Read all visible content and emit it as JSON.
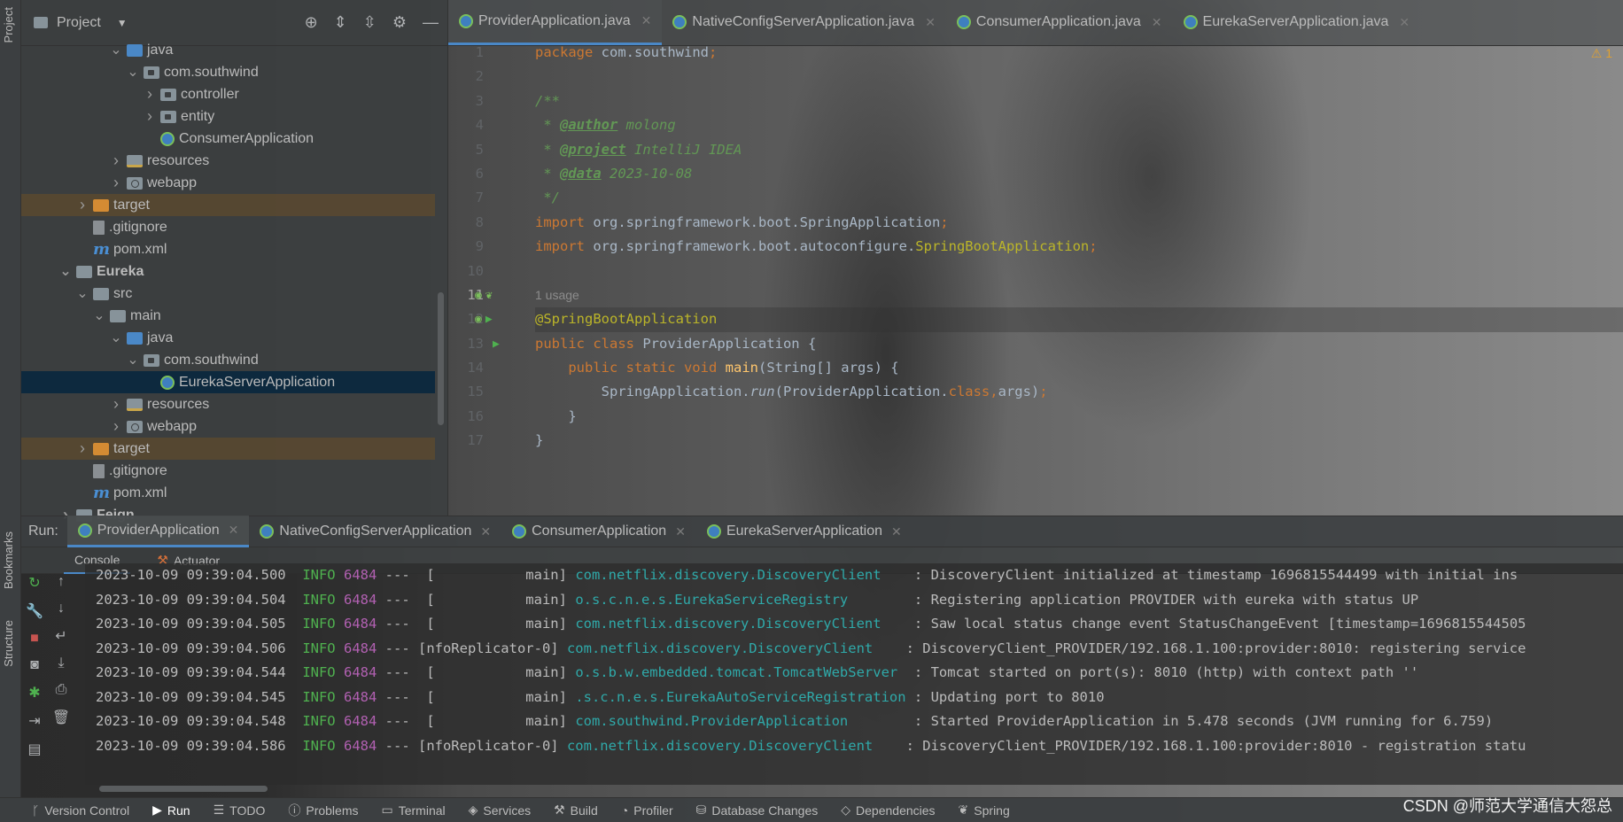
{
  "project_panel": {
    "title": "Project",
    "tree": [
      {
        "label": "java",
        "indent": 5,
        "icon": "folder-blue",
        "chev": "v"
      },
      {
        "label": "com.southwind",
        "indent": 6,
        "icon": "pkg",
        "chev": "v"
      },
      {
        "label": "controller",
        "indent": 7,
        "icon": "pkg",
        "chev": ">"
      },
      {
        "label": "entity",
        "indent": 7,
        "icon": "pkg",
        "chev": ">"
      },
      {
        "label": "ConsumerApplication",
        "indent": 7,
        "icon": "spring",
        "chev": ""
      },
      {
        "label": "resources",
        "indent": 5,
        "icon": "folder-res",
        "chev": ">"
      },
      {
        "label": "webapp",
        "indent": 5,
        "icon": "web",
        "chev": ">"
      },
      {
        "label": "target",
        "indent": 3,
        "icon": "folder-orange",
        "chev": ">",
        "hl": true
      },
      {
        "label": ".gitignore",
        "indent": 3,
        "icon": "file",
        "chev": ""
      },
      {
        "label": "pom.xml",
        "indent": 3,
        "icon": "maven",
        "chev": ""
      },
      {
        "label": "Eureka",
        "indent": 2,
        "icon": "folder",
        "chev": "v",
        "bold": true
      },
      {
        "label": "src",
        "indent": 3,
        "icon": "folder",
        "chev": "v"
      },
      {
        "label": "main",
        "indent": 4,
        "icon": "folder",
        "chev": "v"
      },
      {
        "label": "java",
        "indent": 5,
        "icon": "folder-blue",
        "chev": "v"
      },
      {
        "label": "com.southwind",
        "indent": 6,
        "icon": "pkg",
        "chev": "v"
      },
      {
        "label": "EurekaServerApplication",
        "indent": 7,
        "icon": "spring",
        "chev": "",
        "sel": true
      },
      {
        "label": "resources",
        "indent": 5,
        "icon": "folder-res",
        "chev": ">"
      },
      {
        "label": "webapp",
        "indent": 5,
        "icon": "web",
        "chev": ">"
      },
      {
        "label": "target",
        "indent": 3,
        "icon": "folder-orange",
        "chev": ">",
        "hl": true
      },
      {
        "label": ".gitignore",
        "indent": 3,
        "icon": "file",
        "chev": ""
      },
      {
        "label": "pom.xml",
        "indent": 3,
        "icon": "maven",
        "chev": ""
      },
      {
        "label": "Feign",
        "indent": 2,
        "icon": "folder",
        "chev": ">",
        "bold": true
      }
    ]
  },
  "editor": {
    "tabs": [
      {
        "label": "ProviderApplication.java",
        "active": true
      },
      {
        "label": "NativeConfigServerApplication.java",
        "active": false
      },
      {
        "label": "ConsumerApplication.java",
        "active": false
      },
      {
        "label": "EurekaServerApplication.java",
        "active": false
      }
    ],
    "warning_count": "1",
    "usage_hint": "1 usage",
    "line_numbers": [
      "1",
      "2",
      "3",
      "4",
      "5",
      "6",
      "7",
      "8",
      "9",
      "10",
      "11",
      "12",
      "13",
      "14",
      "15",
      "16",
      "17"
    ]
  },
  "run_panel": {
    "label": "Run:",
    "tabs": [
      {
        "label": "ProviderApplication",
        "active": true
      },
      {
        "label": "NativeConfigServerApplication",
        "active": false
      },
      {
        "label": "ConsumerApplication",
        "active": false
      },
      {
        "label": "EurekaServerApplication",
        "active": false
      }
    ],
    "sub_tabs": [
      "Console",
      "Actuator"
    ],
    "console_lines": [
      {
        "ts": "2023-10-09 09:39:04.500",
        "level": "INFO",
        "pid": "6484",
        "thread": "---  [           main]",
        "logger": "com.netflix.discovery.DiscoveryClient   ",
        "msg": " : DiscoveryClient initialized at timestamp 1696815544499 with initial ins"
      },
      {
        "ts": "2023-10-09 09:39:04.504",
        "level": "INFO",
        "pid": "6484",
        "thread": "---  [           main]",
        "logger": "o.s.c.n.e.s.EurekaServiceRegistry       ",
        "msg": " : Registering application PROVIDER with eureka with status UP"
      },
      {
        "ts": "2023-10-09 09:39:04.505",
        "level": "INFO",
        "pid": "6484",
        "thread": "---  [           main]",
        "logger": "com.netflix.discovery.DiscoveryClient   ",
        "msg": " : Saw local status change event StatusChangeEvent [timestamp=1696815544505"
      },
      {
        "ts": "2023-10-09 09:39:04.506",
        "level": "INFO",
        "pid": "6484",
        "thread": "--- [nfoReplicator-0]",
        "logger": "com.netflix.discovery.DiscoveryClient   ",
        "msg": " : DiscoveryClient_PROVIDER/192.168.1.100:provider:8010: registering service"
      },
      {
        "ts": "2023-10-09 09:39:04.544",
        "level": "INFO",
        "pid": "6484",
        "thread": "---  [           main]",
        "logger": "o.s.b.w.embedded.tomcat.TomcatWebServer ",
        "msg": " : Tomcat started on port(s): 8010 (http) with context path ''"
      },
      {
        "ts": "2023-10-09 09:39:04.545",
        "level": "INFO",
        "pid": "6484",
        "thread": "---  [           main]",
        "logger": ".s.c.n.e.s.EurekaAutoServiceRegistration",
        "msg": " : Updating port to 8010"
      },
      {
        "ts": "2023-10-09 09:39:04.548",
        "level": "INFO",
        "pid": "6484",
        "thread": "---  [           main]",
        "logger": "com.southwind.ProviderApplication       ",
        "msg": " : Started ProviderApplication in 5.478 seconds (JVM running for 6.759)"
      },
      {
        "ts": "2023-10-09 09:39:04.586",
        "level": "INFO",
        "pid": "6484",
        "thread": "--- [nfoReplicator-0]",
        "logger": "com.netflix.discovery.DiscoveryClient   ",
        "msg": " : DiscoveryClient_PROVIDER/192.168.1.100:provider:8010 - registration statu"
      }
    ]
  },
  "left_strip": {
    "project": "Project",
    "bookmarks": "Bookmarks",
    "structure": "Structure"
  },
  "statusbar": [
    {
      "label": "Version Control",
      "icon": "branch-icon"
    },
    {
      "label": "Run",
      "icon": "run-icon",
      "active": true
    },
    {
      "label": "TODO",
      "icon": "todo-icon"
    },
    {
      "label": "Problems",
      "icon": "problems-icon"
    },
    {
      "label": "Terminal",
      "icon": "terminal-icon"
    },
    {
      "label": "Services",
      "icon": "services-icon"
    },
    {
      "label": "Build",
      "icon": "build-icon"
    },
    {
      "label": "Profiler",
      "icon": "profiler-icon"
    },
    {
      "label": "Database Changes",
      "icon": "database-icon"
    },
    {
      "label": "Dependencies",
      "icon": "dependencies-icon"
    },
    {
      "label": "Spring",
      "icon": "spring-icon"
    }
  ],
  "watermark": "CSDN @师范大学通信大怨总"
}
